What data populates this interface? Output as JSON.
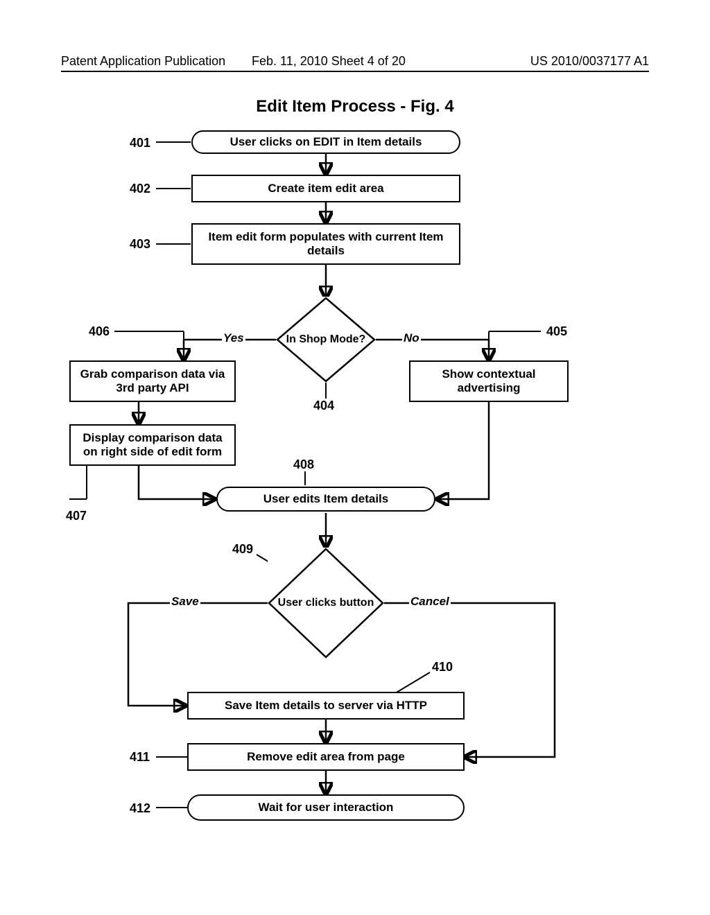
{
  "header": {
    "left": "Patent Application Publication",
    "mid": "Feb. 11, 2010  Sheet 4 of 20",
    "right": "US 2010/0037177 A1"
  },
  "title": "Edit Item Process - Fig. 4",
  "nodes": {
    "n401": "User clicks on EDIT in Item details",
    "n402": "Create item edit area",
    "n403": "Item edit form populates with current Item details",
    "n404": "In Shop Mode?",
    "n405": "Show contextual advertising",
    "n406": "Grab comparison data via 3rd party API",
    "n407": "Display comparison data on right side of edit form",
    "n408": "User edits Item details",
    "n409": "User clicks button",
    "n410": "Save Item details to server via HTTP",
    "n411": "Remove edit area from page",
    "n412": "Wait for user interaction"
  },
  "refs": {
    "r401": "401",
    "r402": "402",
    "r403": "403",
    "r404": "404",
    "r405": "405",
    "r406": "406",
    "r407": "407",
    "r408": "408",
    "r409": "409",
    "r410": "410",
    "r411": "411",
    "r412": "412"
  },
  "edge_labels": {
    "yes": "Yes",
    "no": "No",
    "save": "Save",
    "cancel": "Cancel"
  }
}
